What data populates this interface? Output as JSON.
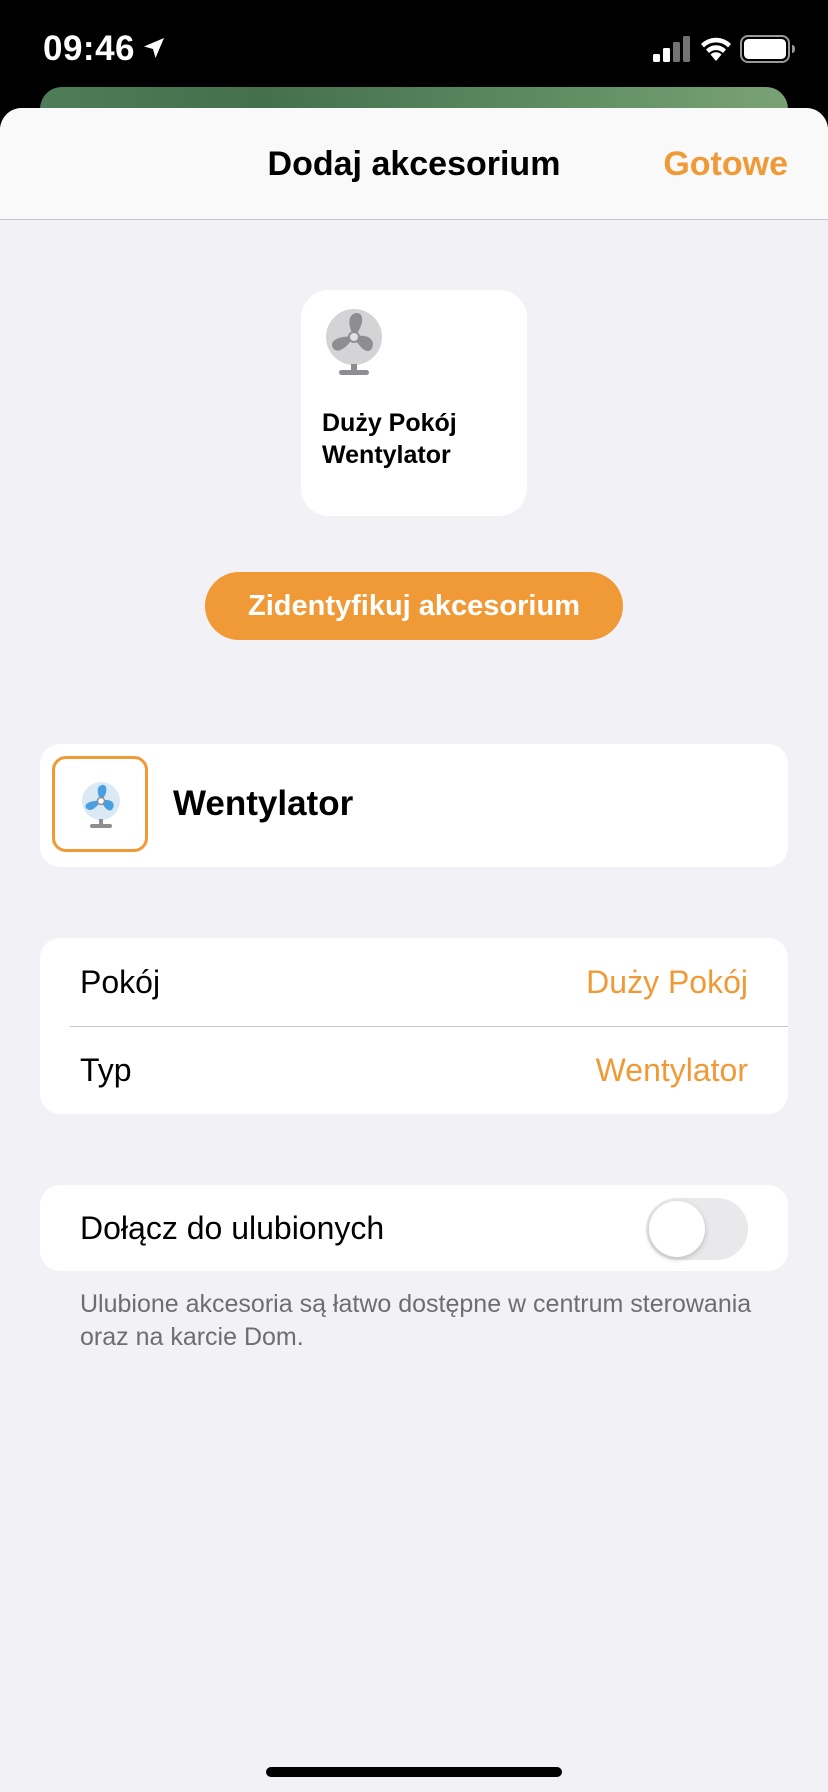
{
  "status_bar": {
    "time": "09:46",
    "location_icon": "location-arrow-icon",
    "signal_icon": "cellular-signal-icon",
    "wifi_icon": "wifi-icon",
    "battery_icon": "battery-icon"
  },
  "nav": {
    "title": "Dodaj akcesorium",
    "done_label": "Gotowe"
  },
  "tile": {
    "icon": "fan-icon",
    "label_line1": "Duży Pokój",
    "label_line2": "Wentylator"
  },
  "identify_button": {
    "label": "Zidentyfikuj akcesorium"
  },
  "name_card": {
    "icon": "fan-icon",
    "name": "Wentylator"
  },
  "settings": {
    "rows": [
      {
        "label": "Pokój",
        "value": "Duży Pokój"
      },
      {
        "label": "Typ",
        "value": "Wentylator"
      }
    ]
  },
  "favorites": {
    "label": "Dołącz do ulubionych",
    "enabled": false,
    "footnote": "Ulubione akcesoria są łatwo dostępne w centrum sterowania oraz na karcie Dom."
  },
  "colors": {
    "accent": "#f09a37",
    "background": "#f2f2f6",
    "card": "#ffffff"
  }
}
